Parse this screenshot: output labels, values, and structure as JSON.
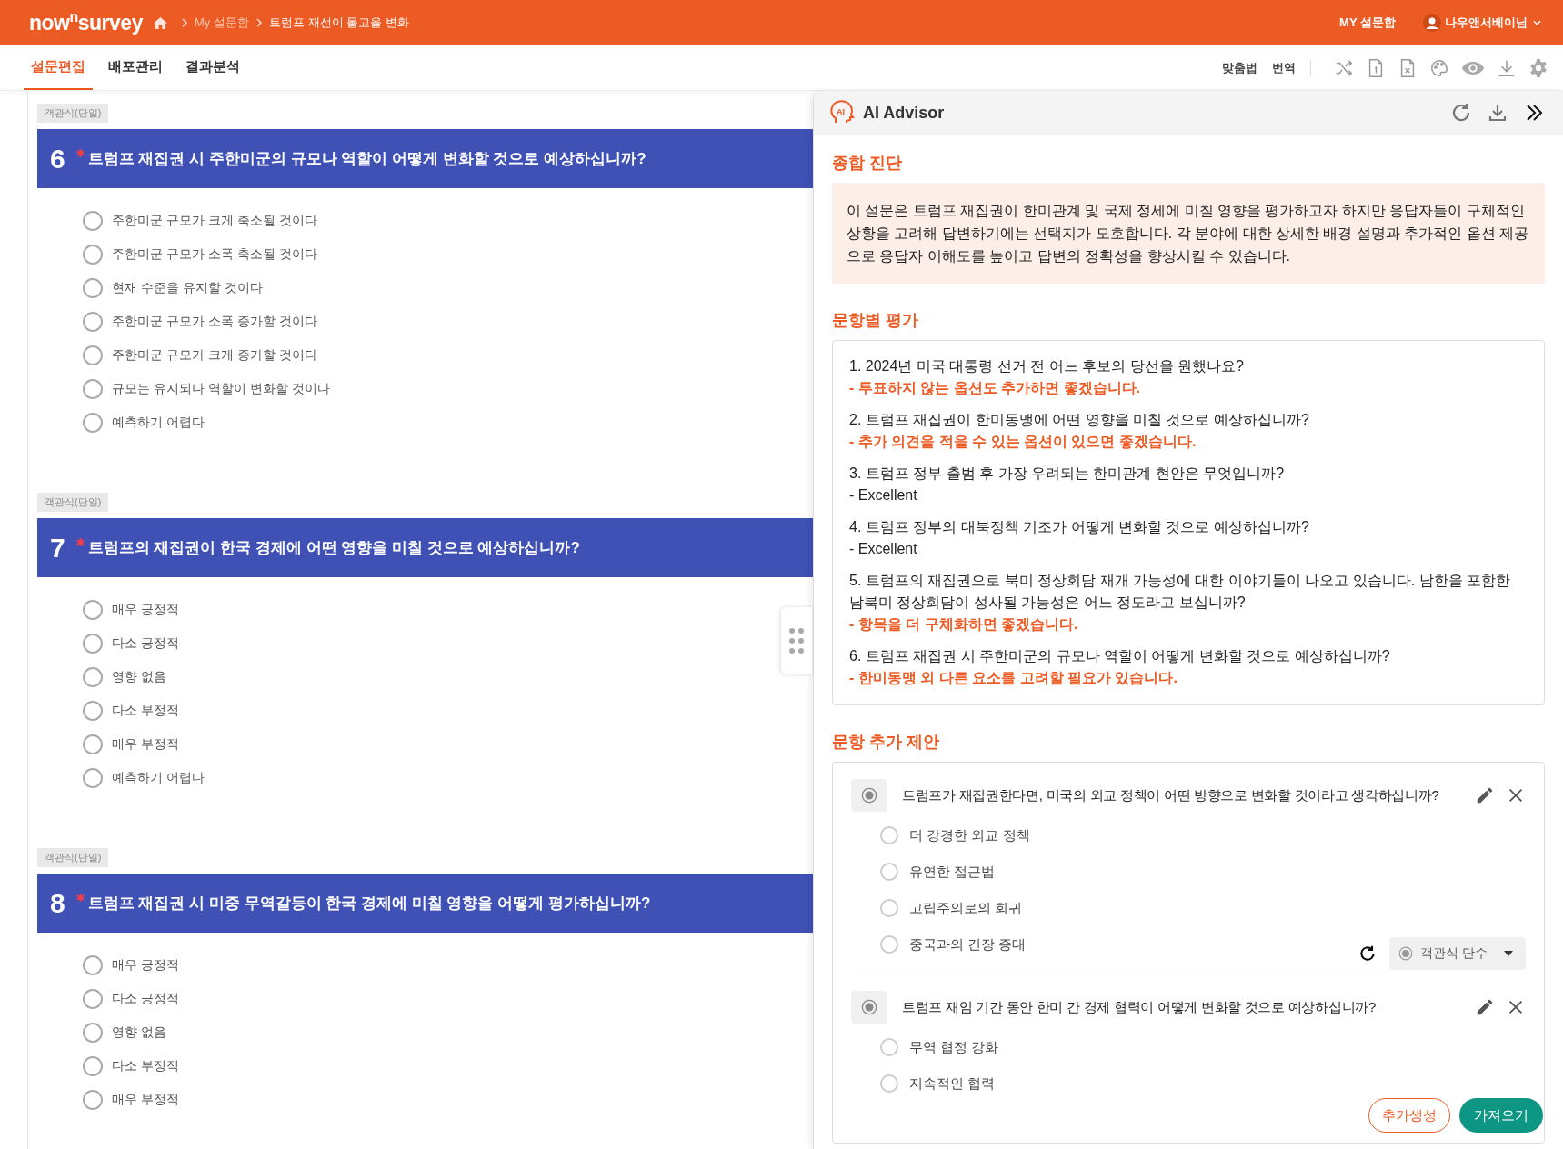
{
  "topbar": {
    "logo_main": "now",
    "logo_sup": "n",
    "logo_end": "survey",
    "breadcrumb": [
      "My 설문함",
      "트럼프 재선이 몰고올 변화"
    ],
    "my_box": "MY 설문함",
    "user": "나우앤서베이님"
  },
  "tabs": [
    {
      "label": "설문편집",
      "selected": true
    },
    {
      "label": "배포관리",
      "selected": false
    },
    {
      "label": "결과분석",
      "selected": false
    }
  ],
  "toolbar": {
    "links": [
      "맞춤법",
      "번역"
    ]
  },
  "questions": [
    {
      "type_tag": "객관식(단일)",
      "number": "6",
      "required": true,
      "title": "트럼프 재집권 시 주한미군의 규모나 역할이 어떻게 변화할 것으로 예상하십니까?",
      "options": [
        {
          "label": "주한미군 규모가 크게 축소될 것이다",
          "selected": false
        },
        {
          "label": "주한미군 규모가 소폭 축소될 것이다",
          "selected": false
        },
        {
          "label": "현재 수준을 유지할 것이다",
          "selected": false
        },
        {
          "label": "주한미군 규모가 소폭 증가할 것이다",
          "selected": false
        },
        {
          "label": "주한미군 규모가 크게 증가할 것이다",
          "selected": false
        },
        {
          "label": "규모는 유지되나 역할이 변화할 것이다",
          "selected": false
        },
        {
          "label": "예측하기 어렵다",
          "selected": false
        }
      ]
    },
    {
      "type_tag": "객관식(단일)",
      "number": "7",
      "required": true,
      "title": "트럼프의 재집권이 한국 경제에 어떤 영향을 미칠 것으로 예상하십니까?",
      "options": [
        {
          "label": "매우 긍정적",
          "selected": false
        },
        {
          "label": "다소 긍정적",
          "selected": false
        },
        {
          "label": "영향 없음",
          "selected": false
        },
        {
          "label": "다소 부정적",
          "selected": false
        },
        {
          "label": "매우 부정적",
          "selected": false
        },
        {
          "label": "예측하기 어렵다",
          "selected": false
        }
      ]
    },
    {
      "type_tag": "객관식(단일)",
      "number": "8",
      "required": true,
      "title": "트럼프 재집권 시 미중 무역갈등이 한국 경제에 미칠 영향을 어떻게 평가하십니까?",
      "options": [
        {
          "label": "매우 긍정적",
          "selected": false
        },
        {
          "label": "다소 긍정적",
          "selected": false
        },
        {
          "label": "영향 없음",
          "selected": false
        },
        {
          "label": "다소 부정적",
          "selected": false
        },
        {
          "label": "매우 부정적",
          "selected": false
        }
      ]
    }
  ],
  "advisor": {
    "icon_label": "AI",
    "title": "AI Advisor",
    "diagnosis_heading": "종합 진단",
    "diagnosis": "이 설문은 트럼프 재집권이 한미관계 및 국제 정세에 미칠 영향을 평가하고자 하지만  응답자들이 구체적인 상황을 고려해 답변하기에는 선택지가 모호합니다. 각 분야에 대한 상세한 배경 설명과 추가적인 옵션 제공으로 응답자 이해도를 높이고 답변의 정확성을 향상시킬 수 있습니다.",
    "evaluation_heading": "문항별 평가",
    "evaluations": [
      {
        "question": "1. 2024년 미국 대통령 선거 전 어느 후보의 당선을 원했나요?",
        "comment": "- 투표하지 않는 옵션도 추가하면 좋겠습니다.",
        "kind": "suggestion"
      },
      {
        "question": "2. 트럼프 재집권이 한미동맹에 어떤 영향을 미칠 것으로 예상하십니까?",
        "comment": "- 추가 의견을 적을 수 있는 옵션이 있으면 좋겠습니다.",
        "kind": "suggestion"
      },
      {
        "question": "3. 트럼프 정부 출범 후 가장 우려되는 한미관계 현안은 무엇입니까?",
        "comment": "- Excellent",
        "kind": "ok"
      },
      {
        "question": "4. 트럼프 정부의 대북정책 기조가 어떻게 변화할 것으로 예상하십니까?",
        "comment": "- Excellent",
        "kind": "ok"
      },
      {
        "question": "5. 트럼프의 재집권으로 북미 정상회담 재개 가능성에 대한 이야기들이 나오고  있습니다. 남한을 포함한 남북미 정상회담이 성사될 가능성은 어느 정도라고 보십니까?",
        "comment": "- 항목을 더 구체화하면 좋겠습니다.",
        "kind": "suggestion"
      },
      {
        "question": "6. 트럼프 재집권 시 주한미군의 규모나 역할이 어떻게 변화할 것으로 예상하십니까?",
        "comment": "- 한미동맹 외 다른 요소를 고려할 필요가 있습니다.",
        "kind": "suggestion"
      }
    ],
    "suggestion_heading": "문항 추가 제안",
    "suggestions": [
      {
        "title": "트럼프가 재집권한다면, 미국의 외교 정책이 어떤  방향으로 변화할 것이라고 생각하십니까?",
        "options": [
          {
            "label": "더 강경한 외교 정책",
            "selected": false
          },
          {
            "label": "유연한 접근법",
            "selected": false
          },
          {
            "label": "고립주의로의 회귀",
            "selected": false
          },
          {
            "label": "중국과의 긴장 증대",
            "selected": false
          }
        ],
        "type_select": "객관식 단수"
      },
      {
        "title": "트럼프 재임 기간 동안 한미 간 경제 협력이 어떻게 변화할 것으로 예상하십니까?",
        "options": [
          {
            "label": "무역 협정 강화",
            "selected": false
          },
          {
            "label": "지속적인 협력",
            "selected": false
          }
        ]
      }
    ],
    "buttons": {
      "generate": "추가생성",
      "import": "가져오기"
    }
  }
}
